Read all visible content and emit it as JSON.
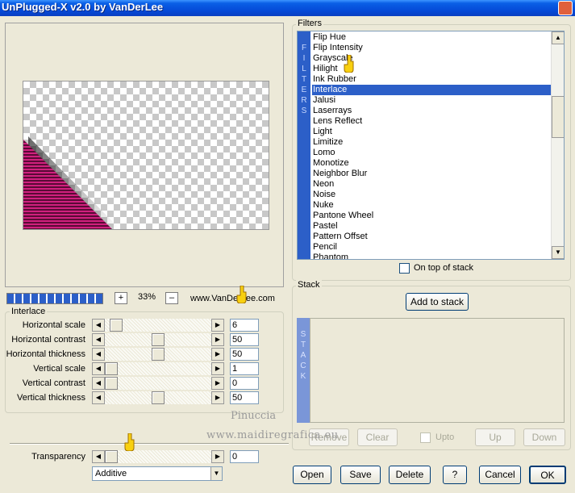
{
  "window": {
    "title": "UnPlugged-X v2.0 by VanDerLee"
  },
  "zoom": {
    "plus": "+",
    "value": "33%",
    "minus": "–"
  },
  "website": "www.VanDerLee.com",
  "interlace_group": {
    "title": "Interlace",
    "params": [
      {
        "label": "Horizontal scale",
        "value": "6",
        "level": 0.05
      },
      {
        "label": "Horizontal contrast",
        "value": "50",
        "level": 0.5
      },
      {
        "label": "Horizontal thickness",
        "value": "50",
        "level": 0.5
      },
      {
        "label": "Vertical scale",
        "value": "1",
        "level": 0.0
      },
      {
        "label": "Vertical contrast",
        "value": "0",
        "level": 0.0
      },
      {
        "label": "Vertical thickness",
        "value": "50",
        "level": 0.5
      }
    ]
  },
  "transparency": {
    "label": "Transparency",
    "value": "0",
    "level": 0.0
  },
  "blend_mode": {
    "selected": "Additive"
  },
  "filters": {
    "title": "Filters",
    "vertical_label": [
      "F",
      "I",
      "L",
      "T",
      "E",
      "R",
      "S"
    ],
    "items": [
      "Flip Hue",
      "Flip Intensity",
      "Grayscale",
      "Hilight",
      "Ink Rubber",
      "Interlace",
      "Jalusi",
      "Laserrays",
      "Lens Reflect",
      "Light",
      "Limitize",
      "Lomo",
      "Monotize",
      "Neighbor Blur",
      "Neon",
      "Noise",
      "Nuke",
      "Pantone Wheel",
      "Pastel",
      "Pattern Offset",
      "Pencil",
      "Phantom"
    ],
    "selected": "Interlace",
    "on_top_label": "On top of stack"
  },
  "stack": {
    "title": "Stack",
    "add_label": "Add to stack",
    "vertical_label": [
      "S",
      "T",
      "A",
      "C",
      "K"
    ],
    "remove_label": "Remove",
    "clear_label": "Clear",
    "upto_label": "Upto",
    "up_label": "Up",
    "down_label": "Down"
  },
  "footer": {
    "open": "Open",
    "save": "Save",
    "delete": "Delete",
    "help": "?",
    "cancel": "Cancel",
    "ok": "OK"
  },
  "watermark": {
    "line1": "Pinuccia",
    "line2": "www.maidiregrafica.eu"
  },
  "colors": {
    "title_blue": "#0548d6",
    "accent_blue": "#2c5fc8",
    "window_bg": "#ece9d8",
    "magenta": "#c8207a"
  }
}
